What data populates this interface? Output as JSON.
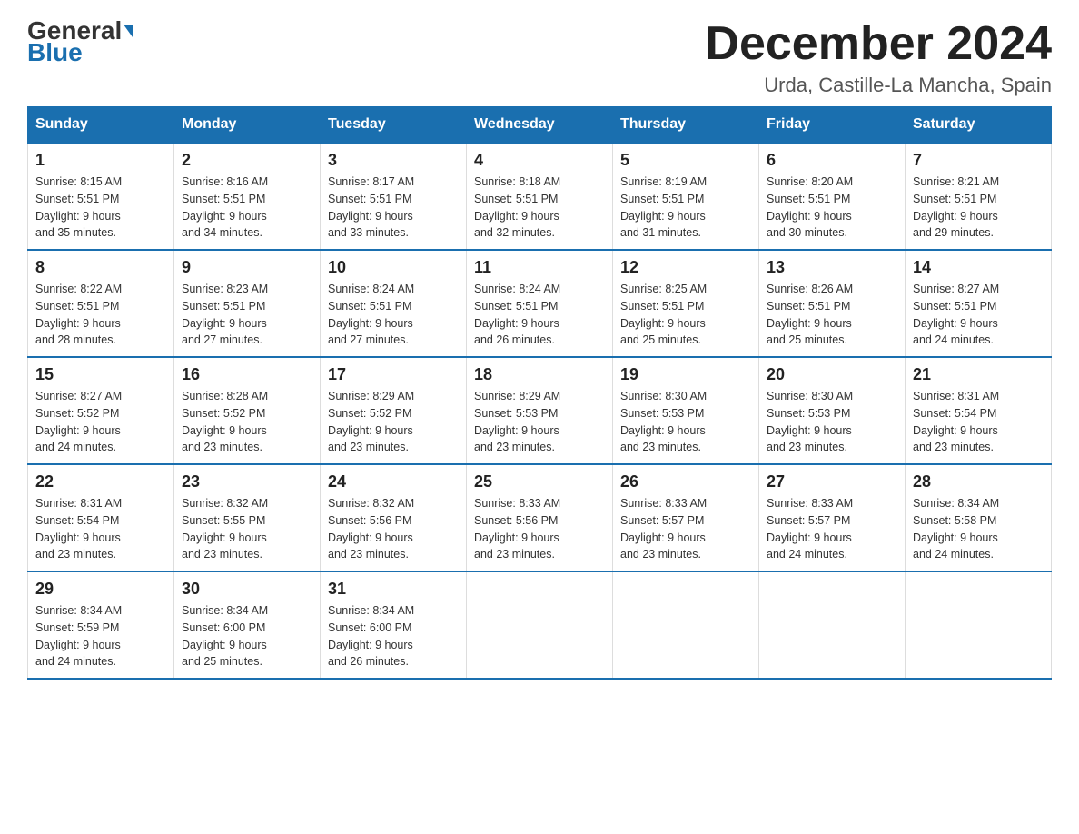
{
  "header": {
    "logo_general": "General",
    "logo_blue": "Blue",
    "month_title": "December 2024",
    "location": "Urda, Castille-La Mancha, Spain"
  },
  "days_of_week": [
    "Sunday",
    "Monday",
    "Tuesday",
    "Wednesday",
    "Thursday",
    "Friday",
    "Saturday"
  ],
  "weeks": [
    [
      {
        "day": "1",
        "sunrise": "8:15 AM",
        "sunset": "5:51 PM",
        "daylight": "9 hours and 35 minutes."
      },
      {
        "day": "2",
        "sunrise": "8:16 AM",
        "sunset": "5:51 PM",
        "daylight": "9 hours and 34 minutes."
      },
      {
        "day": "3",
        "sunrise": "8:17 AM",
        "sunset": "5:51 PM",
        "daylight": "9 hours and 33 minutes."
      },
      {
        "day": "4",
        "sunrise": "8:18 AM",
        "sunset": "5:51 PM",
        "daylight": "9 hours and 32 minutes."
      },
      {
        "day": "5",
        "sunrise": "8:19 AM",
        "sunset": "5:51 PM",
        "daylight": "9 hours and 31 minutes."
      },
      {
        "day": "6",
        "sunrise": "8:20 AM",
        "sunset": "5:51 PM",
        "daylight": "9 hours and 30 minutes."
      },
      {
        "day": "7",
        "sunrise": "8:21 AM",
        "sunset": "5:51 PM",
        "daylight": "9 hours and 29 minutes."
      }
    ],
    [
      {
        "day": "8",
        "sunrise": "8:22 AM",
        "sunset": "5:51 PM",
        "daylight": "9 hours and 28 minutes."
      },
      {
        "day": "9",
        "sunrise": "8:23 AM",
        "sunset": "5:51 PM",
        "daylight": "9 hours and 27 minutes."
      },
      {
        "day": "10",
        "sunrise": "8:24 AM",
        "sunset": "5:51 PM",
        "daylight": "9 hours and 27 minutes."
      },
      {
        "day": "11",
        "sunrise": "8:24 AM",
        "sunset": "5:51 PM",
        "daylight": "9 hours and 26 minutes."
      },
      {
        "day": "12",
        "sunrise": "8:25 AM",
        "sunset": "5:51 PM",
        "daylight": "9 hours and 25 minutes."
      },
      {
        "day": "13",
        "sunrise": "8:26 AM",
        "sunset": "5:51 PM",
        "daylight": "9 hours and 25 minutes."
      },
      {
        "day": "14",
        "sunrise": "8:27 AM",
        "sunset": "5:51 PM",
        "daylight": "9 hours and 24 minutes."
      }
    ],
    [
      {
        "day": "15",
        "sunrise": "8:27 AM",
        "sunset": "5:52 PM",
        "daylight": "9 hours and 24 minutes."
      },
      {
        "day": "16",
        "sunrise": "8:28 AM",
        "sunset": "5:52 PM",
        "daylight": "9 hours and 23 minutes."
      },
      {
        "day": "17",
        "sunrise": "8:29 AM",
        "sunset": "5:52 PM",
        "daylight": "9 hours and 23 minutes."
      },
      {
        "day": "18",
        "sunrise": "8:29 AM",
        "sunset": "5:53 PM",
        "daylight": "9 hours and 23 minutes."
      },
      {
        "day": "19",
        "sunrise": "8:30 AM",
        "sunset": "5:53 PM",
        "daylight": "9 hours and 23 minutes."
      },
      {
        "day": "20",
        "sunrise": "8:30 AM",
        "sunset": "5:53 PM",
        "daylight": "9 hours and 23 minutes."
      },
      {
        "day": "21",
        "sunrise": "8:31 AM",
        "sunset": "5:54 PM",
        "daylight": "9 hours and 23 minutes."
      }
    ],
    [
      {
        "day": "22",
        "sunrise": "8:31 AM",
        "sunset": "5:54 PM",
        "daylight": "9 hours and 23 minutes."
      },
      {
        "day": "23",
        "sunrise": "8:32 AM",
        "sunset": "5:55 PM",
        "daylight": "9 hours and 23 minutes."
      },
      {
        "day": "24",
        "sunrise": "8:32 AM",
        "sunset": "5:56 PM",
        "daylight": "9 hours and 23 minutes."
      },
      {
        "day": "25",
        "sunrise": "8:33 AM",
        "sunset": "5:56 PM",
        "daylight": "9 hours and 23 minutes."
      },
      {
        "day": "26",
        "sunrise": "8:33 AM",
        "sunset": "5:57 PM",
        "daylight": "9 hours and 23 minutes."
      },
      {
        "day": "27",
        "sunrise": "8:33 AM",
        "sunset": "5:57 PM",
        "daylight": "9 hours and 24 minutes."
      },
      {
        "day": "28",
        "sunrise": "8:34 AM",
        "sunset": "5:58 PM",
        "daylight": "9 hours and 24 minutes."
      }
    ],
    [
      {
        "day": "29",
        "sunrise": "8:34 AM",
        "sunset": "5:59 PM",
        "daylight": "9 hours and 24 minutes."
      },
      {
        "day": "30",
        "sunrise": "8:34 AM",
        "sunset": "6:00 PM",
        "daylight": "9 hours and 25 minutes."
      },
      {
        "day": "31",
        "sunrise": "8:34 AM",
        "sunset": "6:00 PM",
        "daylight": "9 hours and 26 minutes."
      },
      null,
      null,
      null,
      null
    ]
  ]
}
